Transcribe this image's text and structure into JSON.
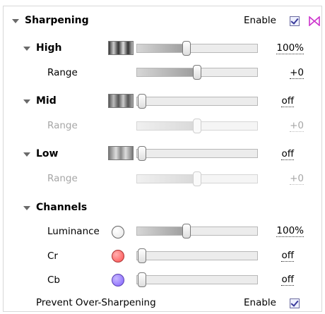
{
  "sharpening": {
    "title": "Sharpening",
    "enable_label": "Enable",
    "enabled": true,
    "bowtie_color": "#cc33cc"
  },
  "high": {
    "title": "High",
    "amount_value": "100%",
    "amount_level": 0.42,
    "range_label": "Range",
    "range_value": "+0",
    "range_level": 0.5
  },
  "mid": {
    "title": "Mid",
    "amount_value": "off",
    "amount_level": 0,
    "range_label": "Range",
    "range_value": "+0",
    "range_level": 0.5
  },
  "low": {
    "title": "Low",
    "amount_value": "off",
    "amount_level": 0,
    "range_label": "Range",
    "range_value": "+0",
    "range_level": 0.5
  },
  "channels": {
    "title": "Channels",
    "items": [
      {
        "label": "Luminance",
        "value": "100%",
        "level": 0.42,
        "color": "#ffffff"
      },
      {
        "label": "Cr",
        "value": "off",
        "level": 0,
        "color": "#ff5555"
      },
      {
        "label": "Cb",
        "value": "off",
        "level": 0,
        "color": "#8a6cff"
      }
    ]
  },
  "prevent": {
    "label": "Prevent Over-Sharpening",
    "enable_label": "Enable",
    "enabled": true
  }
}
